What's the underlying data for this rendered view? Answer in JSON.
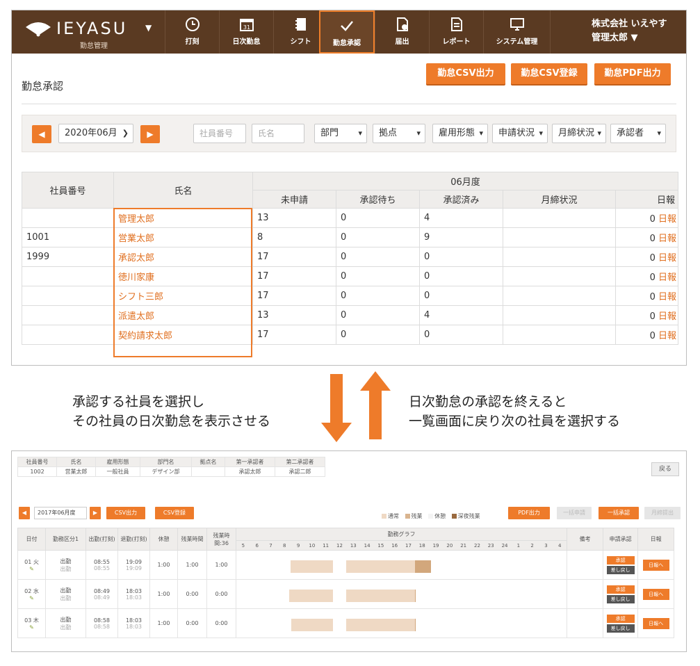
{
  "app": {
    "brand": "IEYASU",
    "brand_sub": "勤怠管理",
    "company": "株式会社 いえやす",
    "user": "管理太郎 ▼"
  },
  "nav": [
    {
      "label": "打刻",
      "icon": "clock-icon"
    },
    {
      "label": "日次勤怠",
      "icon": "calendar-icon"
    },
    {
      "label": "シフト",
      "icon": "notebook-icon"
    },
    {
      "label": "勤怠承認",
      "icon": "checkmark-icon",
      "active": true
    },
    {
      "label": "届出",
      "icon": "document-icon"
    },
    {
      "label": "レポート",
      "icon": "report-icon"
    },
    {
      "label": "システム管理",
      "icon": "monitor-icon"
    }
  ],
  "page": {
    "title": "勤怠承認",
    "buttons": [
      "勤怠CSV出力",
      "勤怠CSV登録",
      "勤怠PDF出力"
    ]
  },
  "filters": {
    "prev": "◀",
    "next": "▶",
    "month": "2020年06月",
    "employee_no_placeholder": "社員番号",
    "name_placeholder": "氏名",
    "selects": [
      "部門",
      "拠点",
      "雇用形態",
      "申請状況",
      "月締状況",
      "承認者"
    ]
  },
  "table": {
    "col_empno": "社員番号",
    "col_name": "氏名",
    "period": "06月度",
    "sub_cols": [
      "未申請",
      "承認待ち",
      "承認済み",
      "月締状況",
      "日報"
    ],
    "rows": [
      {
        "empno": "",
        "name": "管理太郎",
        "unsubmitted": "13",
        "pending": "0",
        "approved": "4",
        "closing": "",
        "diary_count": "0",
        "diary_link": "日報"
      },
      {
        "empno": "1001",
        "name": "営業太郎",
        "unsubmitted": "8",
        "pending": "0",
        "approved": "9",
        "closing": "",
        "diary_count": "0",
        "diary_link": "日報"
      },
      {
        "empno": "1999",
        "name": "承認太郎",
        "unsubmitted": "17",
        "pending": "0",
        "approved": "0",
        "closing": "",
        "diary_count": "0",
        "diary_link": "日報"
      },
      {
        "empno": "",
        "name": "徳川家康",
        "unsubmitted": "17",
        "pending": "0",
        "approved": "0",
        "closing": "",
        "diary_count": "0",
        "diary_link": "日報"
      },
      {
        "empno": "",
        "name": "シフト三郎",
        "unsubmitted": "17",
        "pending": "0",
        "approved": "0",
        "closing": "",
        "diary_count": "0",
        "diary_link": "日報"
      },
      {
        "empno": "",
        "name": "派遣太郎",
        "unsubmitted": "13",
        "pending": "0",
        "approved": "4",
        "closing": "",
        "diary_count": "0",
        "diary_link": "日報"
      },
      {
        "empno": "",
        "name": "契約請求太郎",
        "unsubmitted": "17",
        "pending": "0",
        "approved": "0",
        "closing": "",
        "diary_count": "0",
        "diary_link": "日報"
      }
    ]
  },
  "captions": {
    "left_line1": "承認する社員を選択し",
    "left_line2": "その社員の日次勤怠を表示させる",
    "right_line1": "日次勤怠の承認を終えると",
    "right_line2": "一覧画面に戻り次の社員を選択する"
  },
  "detail": {
    "info_headers": [
      "社員番号",
      "氏名",
      "雇用形態",
      "部門名",
      "拠点名",
      "第一承認者",
      "第二承認者"
    ],
    "info_values": [
      "1002",
      "営業太郎",
      "一般社員",
      "デザイン部",
      "",
      "承認太郎",
      "承認二郎"
    ],
    "back": "戻る",
    "month": "2017年06月度",
    "csv_out": "CSV出力",
    "csv_in": "CSV登録",
    "legend": [
      "通常",
      "残業",
      "休憩",
      "深夜残業"
    ],
    "pdf": "PDF出力",
    "bulk_apply": "一括申請",
    "bulk_approve": "一括承認",
    "monthly_submit": "月締提出",
    "headers": [
      "日付",
      "勤務区分1",
      "出勤(打刻)",
      "退勤(打刻)",
      "休憩",
      "残業時間",
      "残業時間:36",
      "勤務グラフ",
      "備考",
      "申請承認",
      "日報"
    ],
    "hours": [
      "5",
      "6",
      "7",
      "8",
      "9",
      "10",
      "11",
      "12",
      "13",
      "14",
      "15",
      "16",
      "17",
      "18",
      "19",
      "20",
      "21",
      "22",
      "23",
      "24",
      "1",
      "2",
      "3",
      "4"
    ],
    "rows": [
      {
        "date": "01 火",
        "type": "出勤",
        "type2": "出勤",
        "in": "08:55",
        "in2": "08:55",
        "out": "19:09",
        "out2": "19:09",
        "break": "1:00",
        "ot": "1:00",
        "ot36": "1:00",
        "approve": "承認",
        "return": "差し戻し",
        "diary": "日報へ"
      },
      {
        "date": "02 水",
        "type": "出勤",
        "type2": "出勤",
        "in": "08:49",
        "in2": "08:49",
        "out": "18:03",
        "out2": "18:03",
        "break": "1:00",
        "ot": "0:00",
        "ot36": "0:00",
        "approve": "承認",
        "return": "差し戻し",
        "diary": "日報へ"
      },
      {
        "date": "03 木",
        "type": "出勤",
        "type2": "出勤",
        "in": "08:58",
        "in2": "08:58",
        "out": "18:03",
        "out2": "18:03",
        "break": "1:00",
        "ot": "0:00",
        "ot36": "0:00",
        "approve": "承認",
        "return": "差し戻し",
        "diary": "日報へ"
      }
    ]
  },
  "colors": {
    "brand_brown": "#5a3a22",
    "accent_orange": "#ee7b2a",
    "bar_normal": "#e6c9ad",
    "bar_overtime": "#c9996c",
    "arrow": "#ee7b2a"
  }
}
